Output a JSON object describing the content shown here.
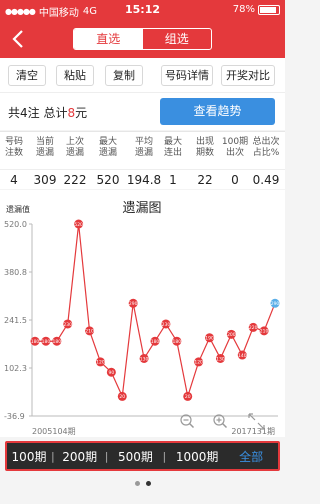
{
  "status": {
    "carrier": "中国移动",
    "network": "4G",
    "time": "15:12",
    "battery": "78%"
  },
  "nav": {
    "tabs": [
      "直选",
      "组选"
    ],
    "active": 0
  },
  "toolbar": {
    "buttons": [
      "清空",
      "粘贴",
      "复制",
      "号码详情",
      "开奖对比"
    ]
  },
  "summary": {
    "prefix": "共4注 总计",
    "amount": "8",
    "suffix": "元",
    "trend_label": "查看趋势"
  },
  "stats": {
    "headers": [
      "号码\n注数",
      "当前\n遗漏",
      "上次\n遗漏",
      "最大\n遗漏",
      "平均\n遗漏",
      "最大\n连出",
      "出现\n期数",
      "100期\n出次",
      "总出次\n占比%"
    ],
    "values": [
      "4",
      "309",
      "222",
      "520",
      "194.8",
      "1",
      "22",
      "0",
      "0.49"
    ]
  },
  "chart_data": {
    "type": "line",
    "title": "遗漏图",
    "ylabel": "遗漏值",
    "y_ticks": [
      "520.0",
      "380.8",
      "241.5",
      "102.3",
      "-36.9"
    ],
    "ylim": [
      -36.9,
      520.0
    ],
    "x_start_label": "2005104期",
    "x_end_label": "2017131期",
    "series": [
      {
        "values": [
          180,
          180,
          180,
          230,
          520,
          210,
          120,
          90,
          20,
          290,
          130,
          180,
          230,
          180,
          20,
          120,
          190,
          130,
          200,
          140,
          220,
          210,
          290
        ],
        "labels": [
          "180",
          "180",
          "180",
          "230",
          "520",
          "210",
          "120",
          "90",
          "20",
          "290",
          "130",
          "180",
          "230",
          "180",
          "20",
          "120",
          "190",
          "130",
          "200",
          "140",
          "220",
          "210",
          "290"
        ]
      }
    ],
    "point_color": "#e4393c",
    "last_point_color": "#5aaee8"
  },
  "controls": {
    "zoom_out": "zoom-out",
    "zoom_in": "zoom-in",
    "fullscreen": "fullscreen"
  },
  "periods": [
    "100期",
    "200期",
    "500期",
    "1000期",
    "全部"
  ]
}
